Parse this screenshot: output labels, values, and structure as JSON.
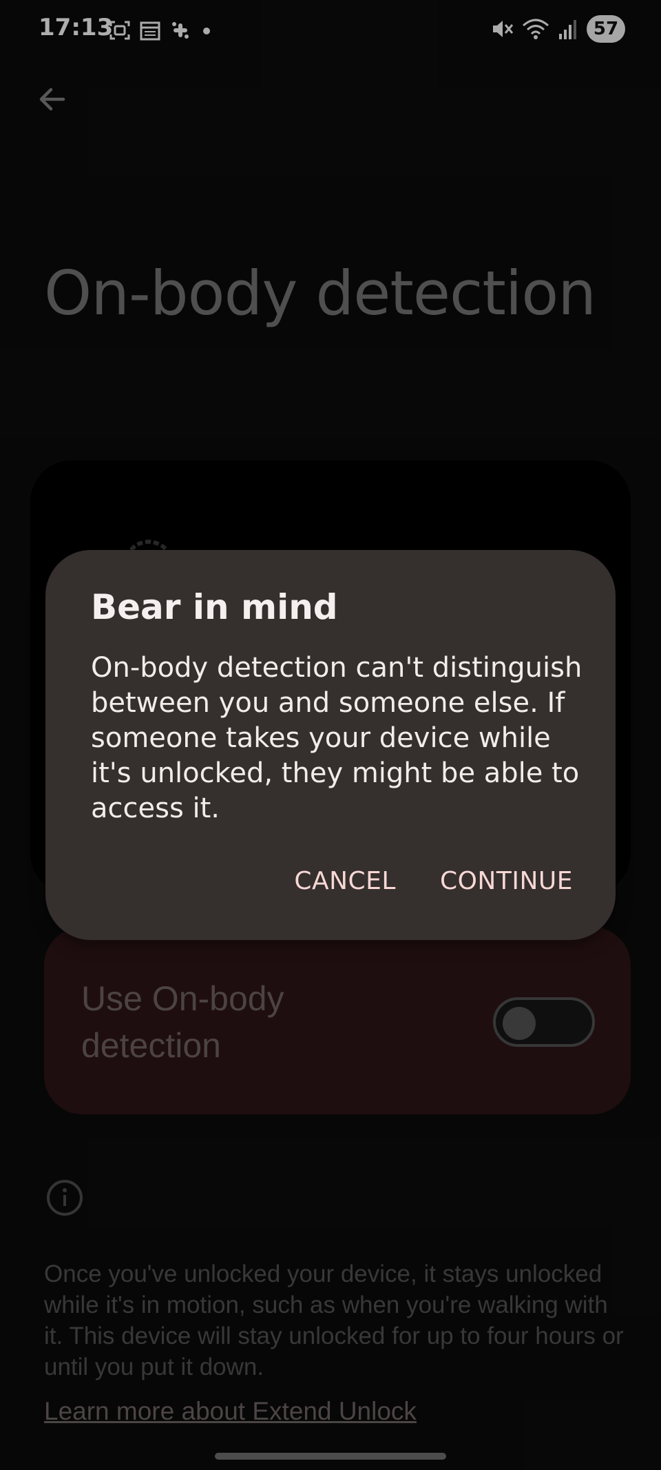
{
  "status_bar": {
    "time": "17:13",
    "left_icons": [
      "screenshot-icon",
      "calendar-icon",
      "slack-icon",
      "dot-icon"
    ],
    "right_icons": [
      "mute-icon",
      "wifi-icon",
      "signal-icon"
    ],
    "battery": "57"
  },
  "page": {
    "title": "On-body detection"
  },
  "toggle": {
    "label": "Use On-body detection",
    "state": "off"
  },
  "info": {
    "text": "Once you've unlocked your device, it stays unlocked while it's in motion, such as when you're walking with it. This device will stay unlocked for up to four hours or until you put it down.",
    "link": "Learn more about Extend Unlock"
  },
  "dialog": {
    "title": "Bear in mind",
    "body": "On-body detection can't distinguish between you and someone else. If someone takes your device while it's unlocked, they might be able to access it.",
    "cancel": "CANCEL",
    "continue": "CONTINUE"
  },
  "colors": {
    "background": "#0b0b0b",
    "dialog": "#352f2e",
    "accent_text": "#f7d8d5",
    "toggle_card": "#2c1416"
  }
}
